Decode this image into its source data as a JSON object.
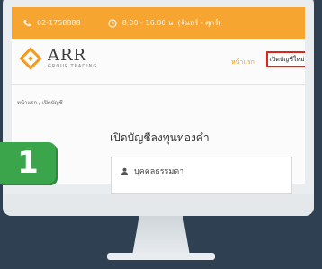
{
  "topbar": {
    "phone": "02-1758888",
    "hours": "8.00 - 16.00 น. (จันทร์ - ศุกร์)"
  },
  "logo": {
    "name": "ARR",
    "tagline": "GROUP TRADING"
  },
  "nav": {
    "home": "หน้าแรก",
    "open_account": "เปิดบัญชีใหม่"
  },
  "breadcrumb": "หน้าแรก / เปิดบัญชี",
  "page_title": "เปิดบัญชีลงทุนทองคำ",
  "card": {
    "label": "บุคคลธรรมดา"
  },
  "step_badge": "1",
  "colors": {
    "topbar": "#f6a531",
    "accent": "#f39b1c",
    "highlight_border": "#e2231a",
    "badge": "#3aa54a",
    "background": "#2f4052"
  }
}
